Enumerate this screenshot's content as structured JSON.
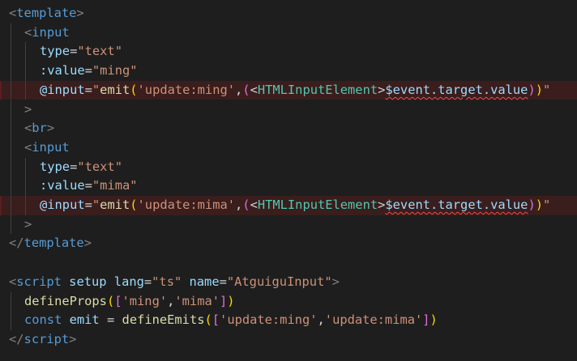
{
  "editor": {
    "lines": {
      "l01": {
        "open": "<",
        "tag": "template",
        "close": ">"
      },
      "l02": {
        "open": "<",
        "tag": "input"
      },
      "l03": {
        "attr": "type",
        "eq": "=",
        "val": "\"text\""
      },
      "l04": {
        "attr": ":value",
        "eq": "=",
        "val": "\"ming\""
      },
      "l05": {
        "attr": "@input",
        "eq": "=",
        "q": "\"",
        "fn": "emit",
        "p1": "(",
        "s1": "'update:ming'",
        "comma": ",",
        "p2": "(",
        "lt": "<",
        "type": "HTMLInputElement",
        "gt": ">",
        "sq": "$event.target.value",
        "p3": ")",
        "p4": ")",
        "q2": "\""
      },
      "l06": {
        "close": ">"
      },
      "l07": {
        "open": "<",
        "tag": "br",
        "close": ">"
      },
      "l08": {
        "open": "<",
        "tag": "input"
      },
      "l09": {
        "attr": "type",
        "eq": "=",
        "val": "\"text\""
      },
      "l10": {
        "attr": ":value",
        "eq": "=",
        "val": "\"mima\""
      },
      "l11": {
        "attr": "@input",
        "eq": "=",
        "q": "\"",
        "fn": "emit",
        "p1": "(",
        "s1": "'update:mima'",
        "comma": ",",
        "p2": "(",
        "lt": "<",
        "type": "HTMLInputElement",
        "gt": ">",
        "sq": "$event.target.value",
        "p3": ")",
        "p4": ")",
        "q2": "\""
      },
      "l12": {
        "close": ">"
      },
      "l13": {
        "open": "</",
        "tag": "template",
        "close": ">"
      },
      "l15": {
        "open": "<",
        "tag": "script",
        "a1": "setup",
        "a2": "lang",
        "eq": "=",
        "v2": "\"ts\"",
        "a3": "name",
        "v3": "\"AtguiguInput\"",
        "close": ">"
      },
      "l16": {
        "fn": "defineProps",
        "p1": "(",
        "b1": "[",
        "s1": "'ming'",
        "comma": ",",
        "s2": "'mima'",
        "b2": "]",
        "p2": ")"
      },
      "l17": {
        "kw": "const",
        "var": "emit",
        "eq": "=",
        "fn": "defineEmits",
        "p1": "(",
        "b1": "[",
        "s1": "'update:ming'",
        "comma": ",",
        "s2": "'update:mima'",
        "b2": "]",
        "p2": ")"
      },
      "l18": {
        "open": "</",
        "tag": "script",
        "close": ">"
      }
    }
  }
}
